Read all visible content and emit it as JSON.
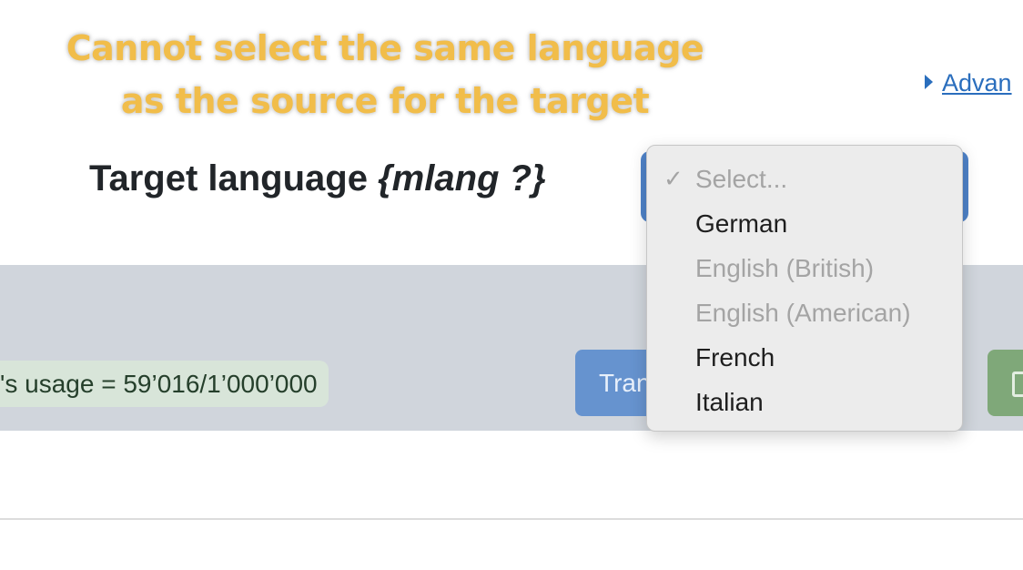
{
  "annotation": {
    "line1": "Cannot select the same language",
    "line2": "as the source for the target"
  },
  "advanced_link": {
    "label": "Advan"
  },
  "target_field": {
    "label": "Target language",
    "placeholder_var": "{mlang ?}"
  },
  "dropdown": {
    "check_mark": "✓",
    "options": [
      {
        "label": "Select...",
        "selected": true,
        "disabled": true
      },
      {
        "label": "German",
        "selected": false,
        "disabled": false
      },
      {
        "label": "English (British)",
        "selected": false,
        "disabled": true
      },
      {
        "label": "English (American)",
        "selected": false,
        "disabled": true
      },
      {
        "label": "French",
        "selected": false,
        "disabled": false
      },
      {
        "label": "Italian",
        "selected": false,
        "disabled": false
      }
    ]
  },
  "toolbar": {
    "usage_text": "'s usage = 59’016/1’000’000",
    "translate_label": "Tran"
  },
  "colors": {
    "annotation": "#f1bd4a",
    "link": "#2a6ebd",
    "select_bg": "#4f83c9",
    "toolbar_bg": "#d0d5dc",
    "usage_badge_bg": "#d8e5d9",
    "translate_button_bg": "#6693cf",
    "save_button_bg": "#7fa879"
  },
  "icons": {
    "advanced_toggle": "triangle-right-icon",
    "save": "floppy-disk-icon",
    "check": "checkmark-icon"
  }
}
